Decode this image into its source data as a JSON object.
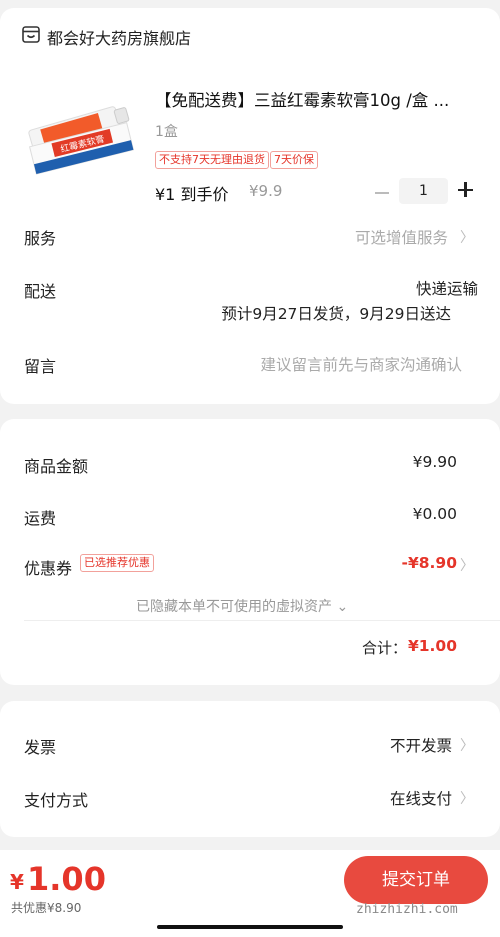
{
  "store": {
    "name": "都会好大药房旗舰店",
    "icon": "store-icon"
  },
  "product": {
    "title": "【免配送费】三益红霉素软膏10g /盒 ...",
    "image_text": "红霉素软膏",
    "spec": "1盒",
    "tags": [
      "不支持7天无理由退货",
      "7天价保"
    ],
    "price_label": "¥1 到手价",
    "original_price": "¥9.9",
    "quantity": "1"
  },
  "rows": {
    "service_label": "服务",
    "service_value": "可选增值服务",
    "delivery_label": "配送",
    "delivery_method": "快递运输",
    "delivery_eta": "预计9月27日发货，9月29日送达",
    "note_label": "留言",
    "note_placeholder": "建议留言前先与商家沟通确认"
  },
  "summary": {
    "goods_label": "商品金额",
    "goods_value": "¥9.90",
    "shipping_label": "运费",
    "shipping_value": "¥0.00",
    "coupon_label": "优惠券",
    "coupon_badge": "已选推荐优惠",
    "coupon_value": "-¥8.90",
    "hidden_assets": "已隐藏本单不可使用的虚拟资产",
    "total_label": "合计：",
    "total_value": "¥1.00"
  },
  "payment": {
    "invoice_label": "发票",
    "invoice_value": "不开发票",
    "pay_label": "支付方式",
    "pay_value": "在线支付"
  },
  "bottom": {
    "currency": "¥",
    "price": "1.00",
    "saved": "共优惠¥8.90",
    "submit": "提交订单"
  },
  "watermark": "zhizhizhi.com",
  "colors": {
    "accent": "#e5352a",
    "submit_bg": "#e84a3f"
  }
}
